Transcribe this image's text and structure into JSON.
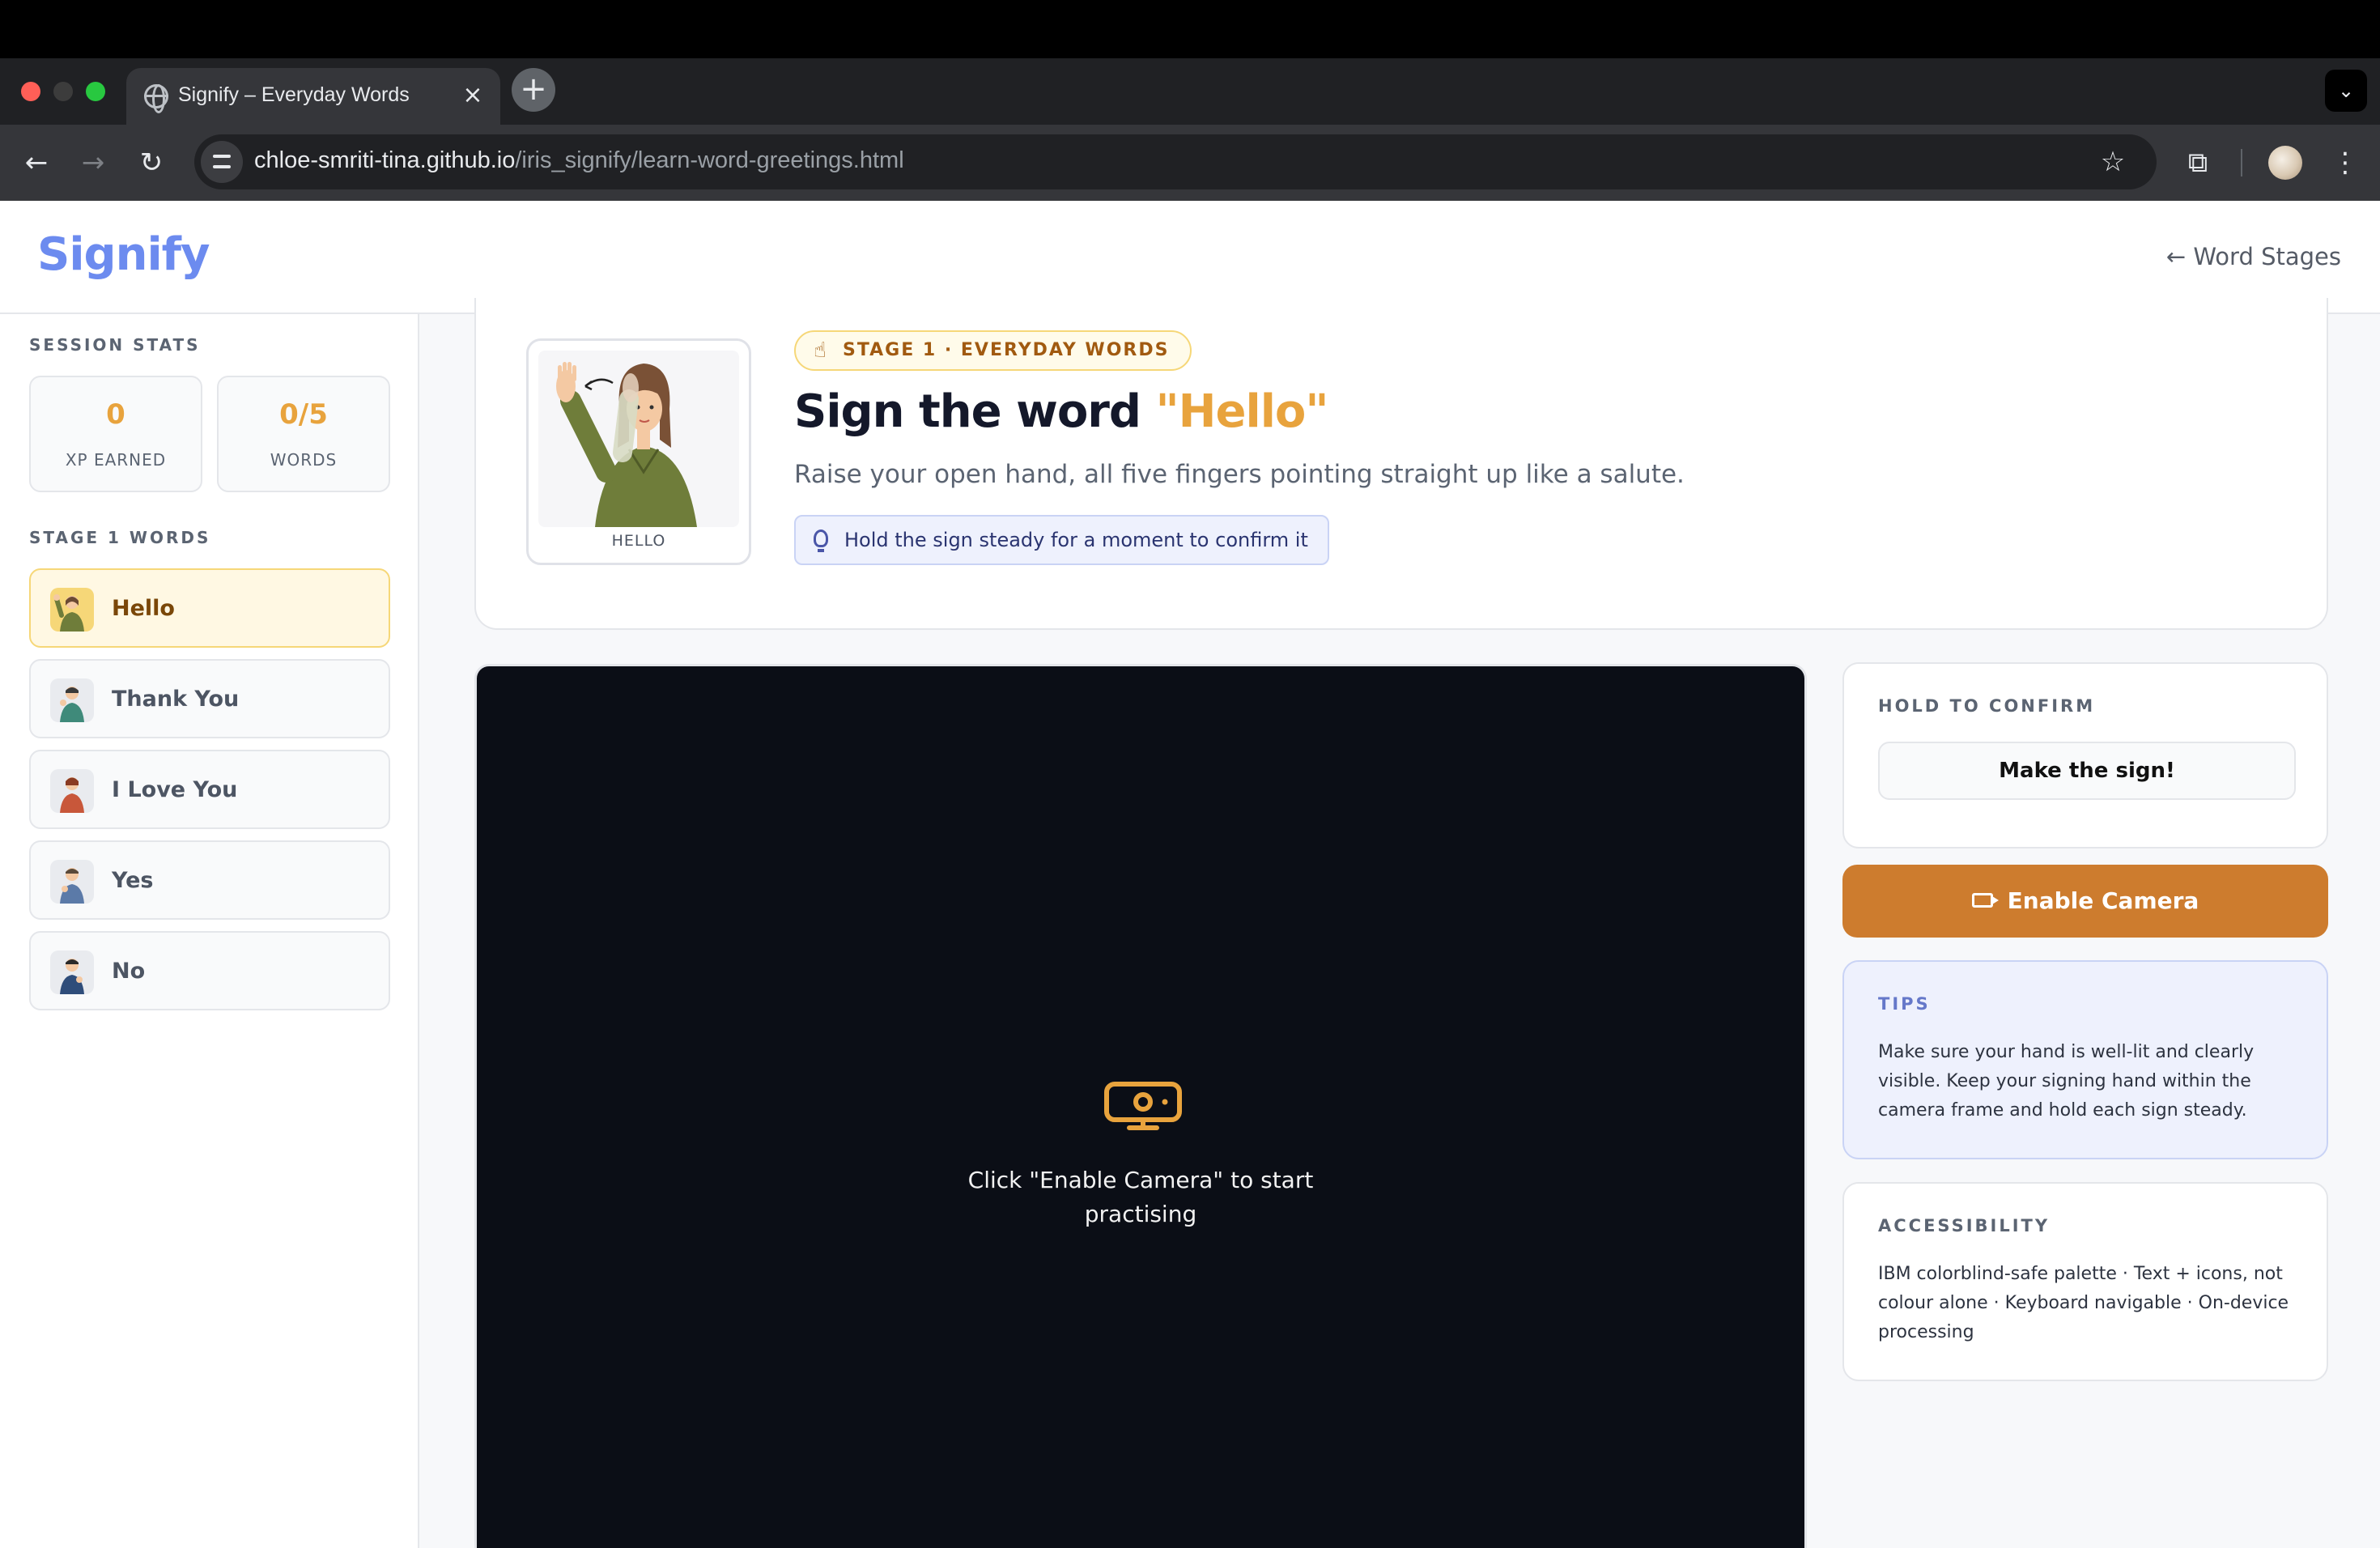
{
  "browser": {
    "tab_title": "Signify – Everyday Words",
    "url_host": "chloe-smriti-tina.github.io",
    "url_path": "/iris_signify/learn-word-greetings.html"
  },
  "header": {
    "logo": "Signify",
    "back_link": "← Word Stages"
  },
  "sidebar": {
    "stats_heading": "SESSION STATS",
    "stats": [
      {
        "value": "0",
        "label": "XP EARNED"
      },
      {
        "value": "0/5",
        "label": "WORDS"
      }
    ],
    "words_heading": "STAGE 1 WORDS",
    "words": [
      {
        "label": "Hello",
        "active": true
      },
      {
        "label": "Thank You",
        "active": false
      },
      {
        "label": "I Love You",
        "active": false
      },
      {
        "label": "Yes",
        "active": false
      },
      {
        "label": "No",
        "active": false
      }
    ]
  },
  "lesson": {
    "illustration_caption": "HELLO",
    "stage_pill": "STAGE 1 · EVERYDAY WORDS",
    "title_prefix": "Sign the word ",
    "title_word": "\"Hello\"",
    "description": "Raise your open hand, all five fingers pointing straight up like a salute.",
    "hint": "Hold the sign steady for a moment to confirm it"
  },
  "camera": {
    "placeholder_line1": "Click \"Enable Camera\" to start",
    "placeholder_line2": "practising"
  },
  "hold_panel": {
    "heading": "HOLD TO CONFIRM",
    "status": "Make the sign!"
  },
  "enable_button": "Enable Camera",
  "tips": {
    "heading": "TIPS",
    "body": "Make sure your hand is well-lit and clearly visible. Keep your signing hand within the camera frame and hold each sign steady."
  },
  "accessibility": {
    "heading": "ACCESSIBILITY",
    "body": "IBM colorblind-safe palette · Text + icons, not colour alone · Keyboard navigable · On-device processing"
  },
  "colors": {
    "brand": "#6c8bef",
    "accent": "#e8a33d",
    "button": "#cd7c2e",
    "camera_bg": "#0b0e16"
  }
}
